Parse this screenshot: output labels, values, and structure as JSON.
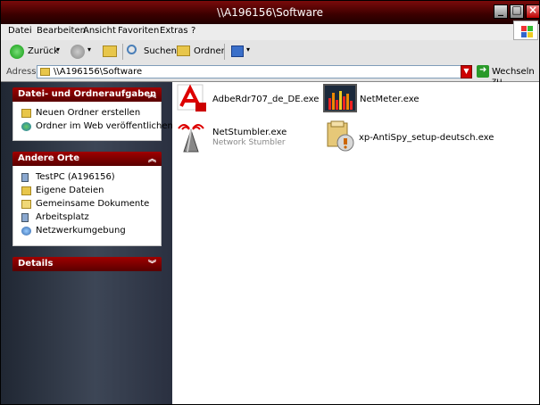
{
  "window": {
    "title": "\\\\A196156\\Software"
  },
  "menu": [
    "Datei",
    "Bearbeiten",
    "Ansicht",
    "Favoriten",
    "Extras",
    "?"
  ],
  "toolbar": {
    "back_label": "Zurück",
    "search_label": "Suchen",
    "folders_label": "Ordner"
  },
  "address": {
    "label": "Adresse",
    "value": "\\\\A196156\\Software",
    "go_label": "Wechseln zu"
  },
  "panels": {
    "tasks": {
      "title": "Datei- und Ordneraufgaben",
      "items": [
        {
          "label": "Neuen Ordner erstellen",
          "icon": "new-folder-icon"
        },
        {
          "label": "Ordner im Web veröffentlichen",
          "icon": "globe-icon"
        }
      ]
    },
    "places": {
      "title": "Andere Orte",
      "items": [
        {
          "label": "TestPC (A196156)",
          "icon": "computer-icon"
        },
        {
          "label": "Eigene Dateien",
          "icon": "folder-icon"
        },
        {
          "label": "Gemeinsame Dokumente",
          "icon": "folder-icon"
        },
        {
          "label": "Arbeitsplatz",
          "icon": "computer-icon"
        },
        {
          "label": "Netzwerkumgebung",
          "icon": "network-icon"
        }
      ]
    },
    "details": {
      "title": "Details"
    }
  },
  "files": [
    {
      "name": "AdbeRdr707_de_DE.exe",
      "icon": "adobe-reader-icon"
    },
    {
      "name": "NetMeter.exe",
      "icon": "netmeter-icon"
    },
    {
      "name": "NetStumbler.exe",
      "subtitle": "Network Stumbler",
      "icon": "netstumbler-icon"
    },
    {
      "name": "xp-AntiSpy_setup-deutsch.exe",
      "icon": "installer-icon"
    }
  ],
  "colors": {
    "accent": "#8b0000",
    "sidebar": "#2a3040"
  }
}
